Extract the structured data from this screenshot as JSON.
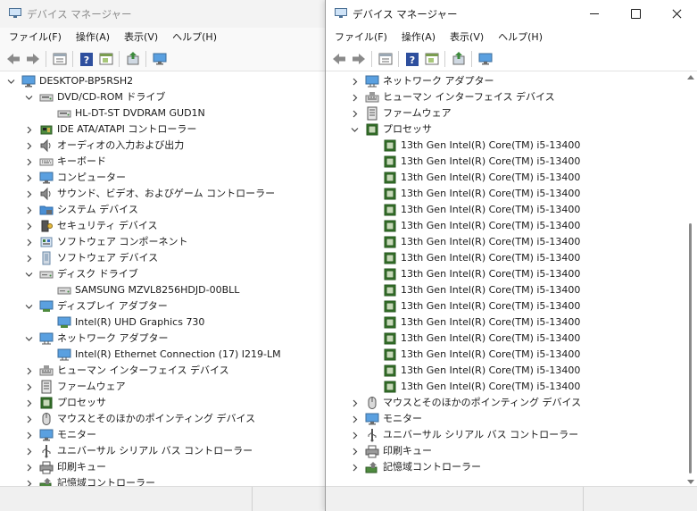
{
  "colors": {
    "accent": "#0f6cbd",
    "chip_green": "#3a7d2c",
    "folder": "#4a8fd4"
  },
  "left_window": {
    "title": "デバイス マネージャー",
    "menu": [
      "ファイル(F)",
      "操作(A)",
      "表示(V)",
      "ヘルプ(H)"
    ],
    "toolbar": [
      "back-arrow-icon",
      "forward-arrow-icon",
      "properties-icon",
      "help-icon",
      "view-icon",
      "update-driver-icon",
      "monitor-icon"
    ],
    "tree": [
      {
        "label": "DESKTOP-BP5RSH2",
        "level": 0,
        "expand": "open",
        "icon": "computer-icon"
      },
      {
        "label": "DVD/CD-ROM ドライブ",
        "level": 1,
        "expand": "open",
        "icon": "dvd-drive-icon"
      },
      {
        "label": "HL-DT-ST DVDRAM GUD1N",
        "level": 2,
        "expand": "none",
        "icon": "dvd-drive-icon"
      },
      {
        "label": "IDE ATA/ATAPI コントローラー",
        "level": 1,
        "expand": "closed",
        "icon": "ide-controller-icon"
      },
      {
        "label": "オーディオの入力および出力",
        "level": 1,
        "expand": "closed",
        "icon": "speaker-icon"
      },
      {
        "label": "キーボード",
        "level": 1,
        "expand": "closed",
        "icon": "keyboard-icon"
      },
      {
        "label": "コンピューター",
        "level": 1,
        "expand": "closed",
        "icon": "monitor-icon"
      },
      {
        "label": "サウンド、ビデオ、およびゲーム コントローラー",
        "level": 1,
        "expand": "closed",
        "icon": "speaker-icon"
      },
      {
        "label": "システム デバイス",
        "level": 1,
        "expand": "closed",
        "icon": "system-folder-icon"
      },
      {
        "label": "セキュリティ デバイス",
        "level": 1,
        "expand": "closed",
        "icon": "security-key-icon"
      },
      {
        "label": "ソフトウェア コンポーネント",
        "level": 1,
        "expand": "closed",
        "icon": "software-component-icon"
      },
      {
        "label": "ソフトウェア デバイス",
        "level": 1,
        "expand": "closed",
        "icon": "software-device-icon"
      },
      {
        "label": "ディスク ドライブ",
        "level": 1,
        "expand": "open",
        "icon": "disk-drive-icon"
      },
      {
        "label": "SAMSUNG MZVL8256HDJD-00BLL",
        "level": 2,
        "expand": "none",
        "icon": "disk-drive-icon"
      },
      {
        "label": "ディスプレイ アダプター",
        "level": 1,
        "expand": "open",
        "icon": "display-adapter-icon"
      },
      {
        "label": "Intel(R) UHD Graphics 730",
        "level": 2,
        "expand": "none",
        "icon": "display-adapter-icon"
      },
      {
        "label": "ネットワーク アダプター",
        "level": 1,
        "expand": "open",
        "icon": "network-adapter-icon"
      },
      {
        "label": "Intel(R) Ethernet Connection (17) I219-LM",
        "level": 2,
        "expand": "none",
        "icon": "network-adapter-icon"
      },
      {
        "label": "ヒューマン インターフェイス デバイス",
        "level": 1,
        "expand": "closed",
        "icon": "hid-icon"
      },
      {
        "label": "ファームウェア",
        "level": 1,
        "expand": "closed",
        "icon": "firmware-icon"
      },
      {
        "label": "プロセッサ",
        "level": 1,
        "expand": "closed",
        "icon": "processor-icon"
      },
      {
        "label": "マウスとそのほかのポインティング デバイス",
        "level": 1,
        "expand": "closed",
        "icon": "mouse-icon"
      },
      {
        "label": "モニター",
        "level": 1,
        "expand": "closed",
        "icon": "monitor-icon"
      },
      {
        "label": "ユニバーサル シリアル バス コントローラー",
        "level": 1,
        "expand": "closed",
        "icon": "usb-icon"
      },
      {
        "label": "印刷キュー",
        "level": 1,
        "expand": "closed",
        "icon": "printer-icon"
      },
      {
        "label": "記憶域コントローラー",
        "level": 1,
        "expand": "closed",
        "icon": "storage-controller-icon"
      }
    ]
  },
  "right_window": {
    "title": "デバイス マネージャー",
    "menu": [
      "ファイル(F)",
      "操作(A)",
      "表示(V)",
      "ヘルプ(H)"
    ],
    "toolbar": [
      "back-arrow-icon",
      "forward-arrow-icon",
      "properties-icon",
      "help-icon",
      "view-icon",
      "update-driver-icon",
      "monitor-icon"
    ],
    "tree": [
      {
        "label": "ネットワーク アダプター",
        "level": 1,
        "expand": "closed",
        "icon": "network-adapter-icon"
      },
      {
        "label": "ヒューマン インターフェイス デバイス",
        "level": 1,
        "expand": "closed",
        "icon": "hid-icon"
      },
      {
        "label": "ファームウェア",
        "level": 1,
        "expand": "closed",
        "icon": "firmware-icon"
      },
      {
        "label": "プロセッサ",
        "level": 1,
        "expand": "open",
        "icon": "processor-icon"
      },
      {
        "label": "13th Gen Intel(R) Core(TM) i5-13400",
        "level": 2,
        "expand": "none",
        "icon": "processor-icon"
      },
      {
        "label": "13th Gen Intel(R) Core(TM) i5-13400",
        "level": 2,
        "expand": "none",
        "icon": "processor-icon"
      },
      {
        "label": "13th Gen Intel(R) Core(TM) i5-13400",
        "level": 2,
        "expand": "none",
        "icon": "processor-icon"
      },
      {
        "label": "13th Gen Intel(R) Core(TM) i5-13400",
        "level": 2,
        "expand": "none",
        "icon": "processor-icon"
      },
      {
        "label": "13th Gen Intel(R) Core(TM) i5-13400",
        "level": 2,
        "expand": "none",
        "icon": "processor-icon"
      },
      {
        "label": "13th Gen Intel(R) Core(TM) i5-13400",
        "level": 2,
        "expand": "none",
        "icon": "processor-icon"
      },
      {
        "label": "13th Gen Intel(R) Core(TM) i5-13400",
        "level": 2,
        "expand": "none",
        "icon": "processor-icon"
      },
      {
        "label": "13th Gen Intel(R) Core(TM) i5-13400",
        "level": 2,
        "expand": "none",
        "icon": "processor-icon"
      },
      {
        "label": "13th Gen Intel(R) Core(TM) i5-13400",
        "level": 2,
        "expand": "none",
        "icon": "processor-icon"
      },
      {
        "label": "13th Gen Intel(R) Core(TM) i5-13400",
        "level": 2,
        "expand": "none",
        "icon": "processor-icon"
      },
      {
        "label": "13th Gen Intel(R) Core(TM) i5-13400",
        "level": 2,
        "expand": "none",
        "icon": "processor-icon"
      },
      {
        "label": "13th Gen Intel(R) Core(TM) i5-13400",
        "level": 2,
        "expand": "none",
        "icon": "processor-icon"
      },
      {
        "label": "13th Gen Intel(R) Core(TM) i5-13400",
        "level": 2,
        "expand": "none",
        "icon": "processor-icon"
      },
      {
        "label": "13th Gen Intel(R) Core(TM) i5-13400",
        "level": 2,
        "expand": "none",
        "icon": "processor-icon"
      },
      {
        "label": "13th Gen Intel(R) Core(TM) i5-13400",
        "level": 2,
        "expand": "none",
        "icon": "processor-icon"
      },
      {
        "label": "13th Gen Intel(R) Core(TM) i5-13400",
        "level": 2,
        "expand": "none",
        "icon": "processor-icon"
      },
      {
        "label": "マウスとそのほかのポインティング デバイス",
        "level": 1,
        "expand": "closed",
        "icon": "mouse-icon"
      },
      {
        "label": "モニター",
        "level": 1,
        "expand": "closed",
        "icon": "monitor-icon"
      },
      {
        "label": "ユニバーサル シリアル バス コントローラー",
        "level": 1,
        "expand": "closed",
        "icon": "usb-icon"
      },
      {
        "label": "印刷キュー",
        "level": 1,
        "expand": "closed",
        "icon": "printer-icon"
      },
      {
        "label": "記憶域コントローラー",
        "level": 1,
        "expand": "closed",
        "icon": "storage-controller-icon"
      }
    ]
  }
}
